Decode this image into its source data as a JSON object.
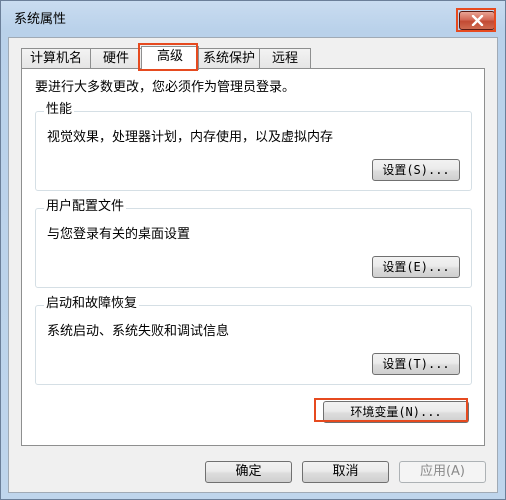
{
  "window": {
    "title": "系统属性"
  },
  "tabs": [
    {
      "label": "计算机名"
    },
    {
      "label": "硬件"
    },
    {
      "label": "高级"
    },
    {
      "label": "系统保护"
    },
    {
      "label": "远程"
    }
  ],
  "panel": {
    "notice": "要进行大多数更改，您必须作为管理员登录。",
    "groups": [
      {
        "title": "性能",
        "desc": "视觉效果，处理器计划，内存使用，以及虚拟内存",
        "button": "设置(S)..."
      },
      {
        "title": "用户配置文件",
        "desc": "与您登录有关的桌面设置",
        "button": "设置(E)..."
      },
      {
        "title": "启动和故障恢复",
        "desc": "系统启动、系统失败和调试信息",
        "button": "设置(T)..."
      }
    ],
    "env_button": "环境变量(N)..."
  },
  "footer": {
    "ok": "确定",
    "cancel": "取消",
    "apply": "应用(A)"
  },
  "colors": {
    "highlight": "#e64a1f",
    "close_button": "#c24a33"
  }
}
